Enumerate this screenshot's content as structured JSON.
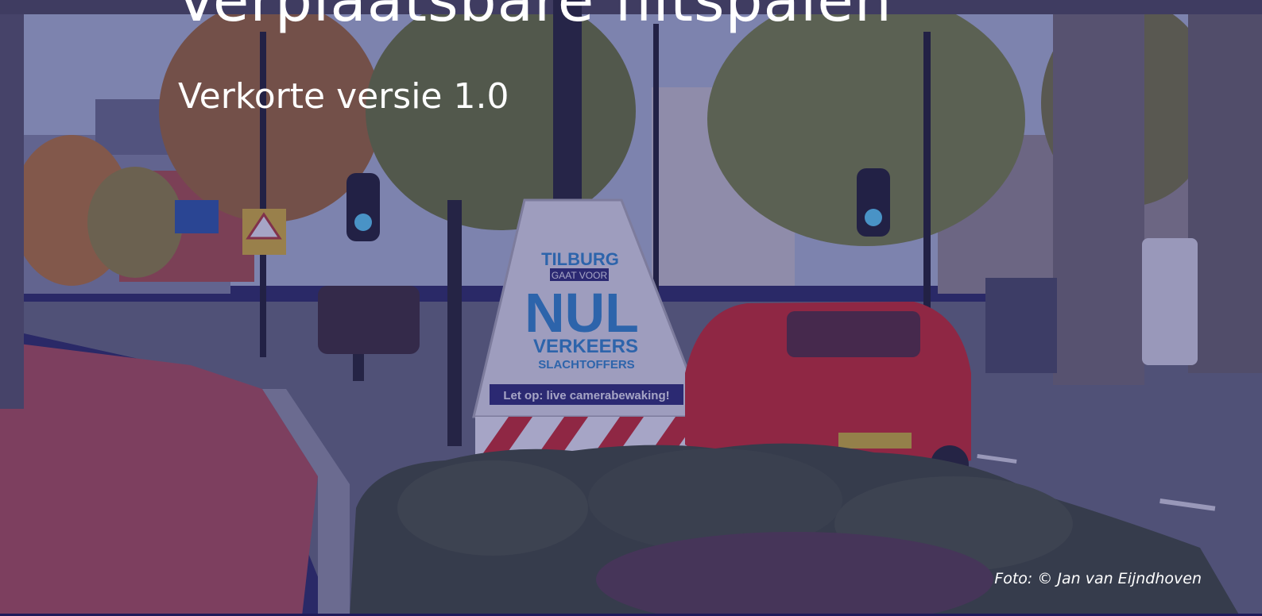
{
  "slide": {
    "title": "Verplaatsbare flitspalen",
    "subtitle": "Verkorte versie 1.0",
    "photo_credit": "Foto: © Jan van Eijndhoven",
    "overlay_color": "#2c2878",
    "rule_color": "#1f1b5a"
  },
  "photo": {
    "sign_brand": "TILBURG",
    "sign_tagline": "GAAT VOOR",
    "sign_main": "NUL",
    "sign_line1": "VERKEERS",
    "sign_line2": "SLACHTOFFERS",
    "sign_footer": "Let op: live camerabewaking!",
    "car_color": "#d8261f"
  }
}
